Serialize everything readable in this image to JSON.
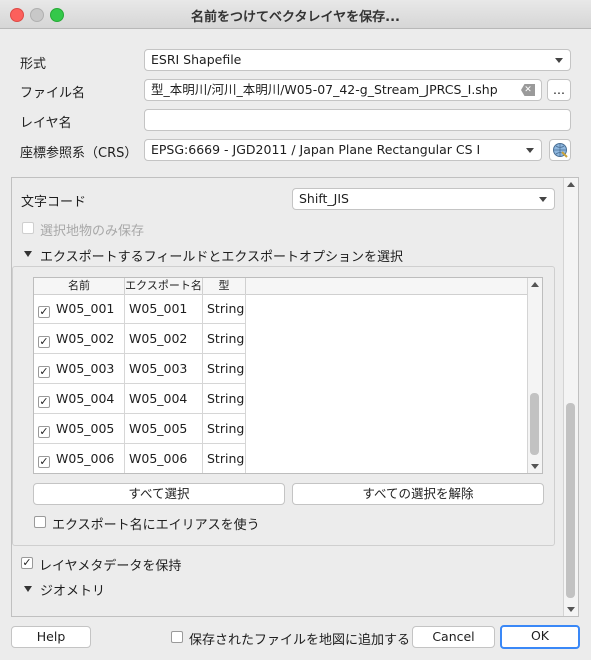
{
  "window": {
    "title": "名前をつけてベクタレイヤを保存..."
  },
  "form": {
    "format_label": "形式",
    "format_value": "ESRI Shapefile",
    "filename_label": "ファイル名",
    "filename_value": "型_本明川/河川_本明川/W05-07_42-g_Stream_JPRCS_I.shp",
    "browse_label": "...",
    "layername_label": "レイヤ名",
    "layername_value": "",
    "crs_label": "座標参照系（CRS）",
    "crs_value": "EPSG:6669 - JGD2011 / Japan Plane Rectangular CS I"
  },
  "panel": {
    "encoding_label": "文字コード",
    "encoding_value": "Shift_JIS",
    "selected_only_label": "選択地物のみ保存",
    "fields_section_label": "エクスポートするフィールドとエクスポートオプションを選択",
    "table": {
      "headers": [
        "名前",
        "エクスポート名",
        "型"
      ],
      "rows": [
        {
          "name": "W05_001",
          "export": "W05_001",
          "type": "String",
          "checked": true
        },
        {
          "name": "W05_002",
          "export": "W05_002",
          "type": "String",
          "checked": true
        },
        {
          "name": "W05_003",
          "export": "W05_003",
          "type": "String",
          "checked": true
        },
        {
          "name": "W05_004",
          "export": "W05_004",
          "type": "String",
          "checked": true
        },
        {
          "name": "W05_005",
          "export": "W05_005",
          "type": "String",
          "checked": true
        },
        {
          "name": "W05_006",
          "export": "W05_006",
          "type": "String",
          "checked": true
        }
      ]
    },
    "select_all_label": "すべて選択",
    "deselect_all_label": "すべての選択を解除",
    "alias_label": "エクスポート名にエイリアスを使う",
    "keep_metadata_label": "レイヤメタデータを保持",
    "geometry_section_label": "ジオメトリ"
  },
  "footer": {
    "help_label": "Help",
    "add_to_map_label": "保存されたファイルを地図に追加する",
    "cancel_label": "Cancel",
    "ok_label": "OK"
  },
  "check_glyph": "✓"
}
